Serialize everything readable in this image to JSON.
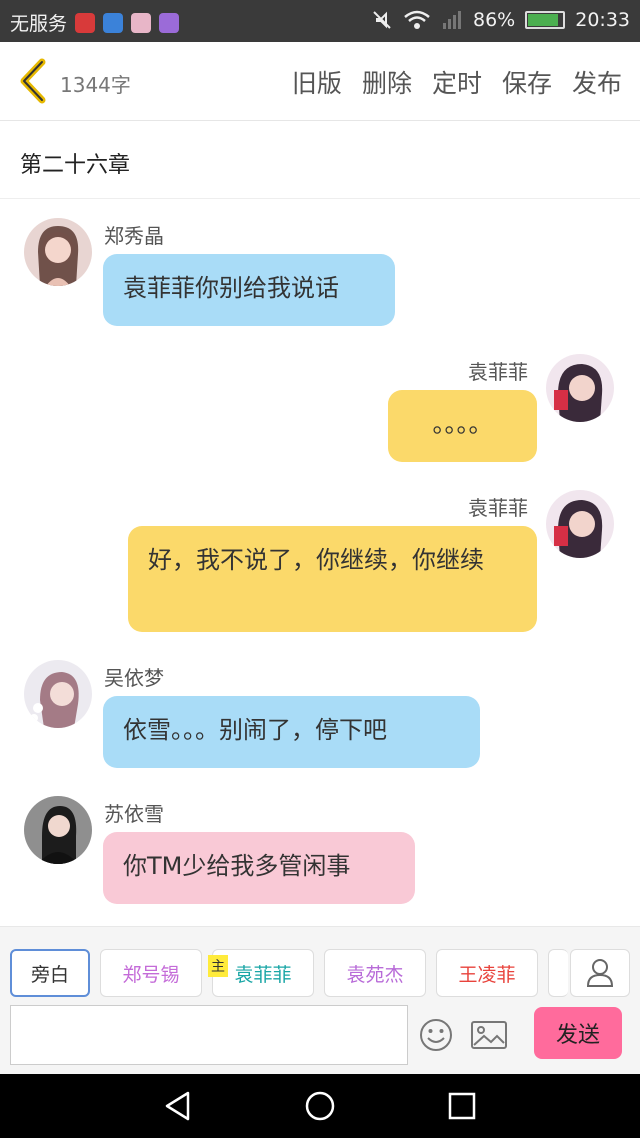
{
  "status_bar": {
    "carrier": "无服务",
    "battery": "86%",
    "time": "20:33"
  },
  "top_bar": {
    "word_count": "1344字",
    "actions": [
      "旧版",
      "删除",
      "定时",
      "保存",
      "发布"
    ]
  },
  "chapter": {
    "title": "第二十六章"
  },
  "messages": [
    {
      "name": "郑秀晶",
      "text": "袁菲菲你别给我说话",
      "side": "left",
      "color": "#a9dcf7"
    },
    {
      "name": "袁菲菲",
      "text": "。。。。",
      "side": "right",
      "color": "#fbd96a"
    },
    {
      "name": "袁菲菲",
      "text": "好，我不说了，你继续，你继续",
      "side": "right",
      "color": "#fbd96a"
    },
    {
      "name": "吴依梦",
      "text": "依雪。。。别闹了，停下吧",
      "side": "left",
      "color": "#a9dcf7"
    },
    {
      "name": "苏依雪",
      "text": "你TM少给我多管闲事",
      "side": "left",
      "color": "#f9c9d6"
    }
  ],
  "characters": [
    {
      "label": "旁白",
      "color": "#333333"
    },
    {
      "label": "郑号锡",
      "color": "#c46bd8"
    },
    {
      "label": "袁菲菲",
      "color": "#1aa6a6",
      "badge": "主"
    },
    {
      "label": "袁苑杰",
      "color": "#b86bd8"
    },
    {
      "label": "王凌菲",
      "color": "#e8433c"
    }
  ],
  "composer": {
    "send_label": "发送",
    "input_value": ""
  }
}
